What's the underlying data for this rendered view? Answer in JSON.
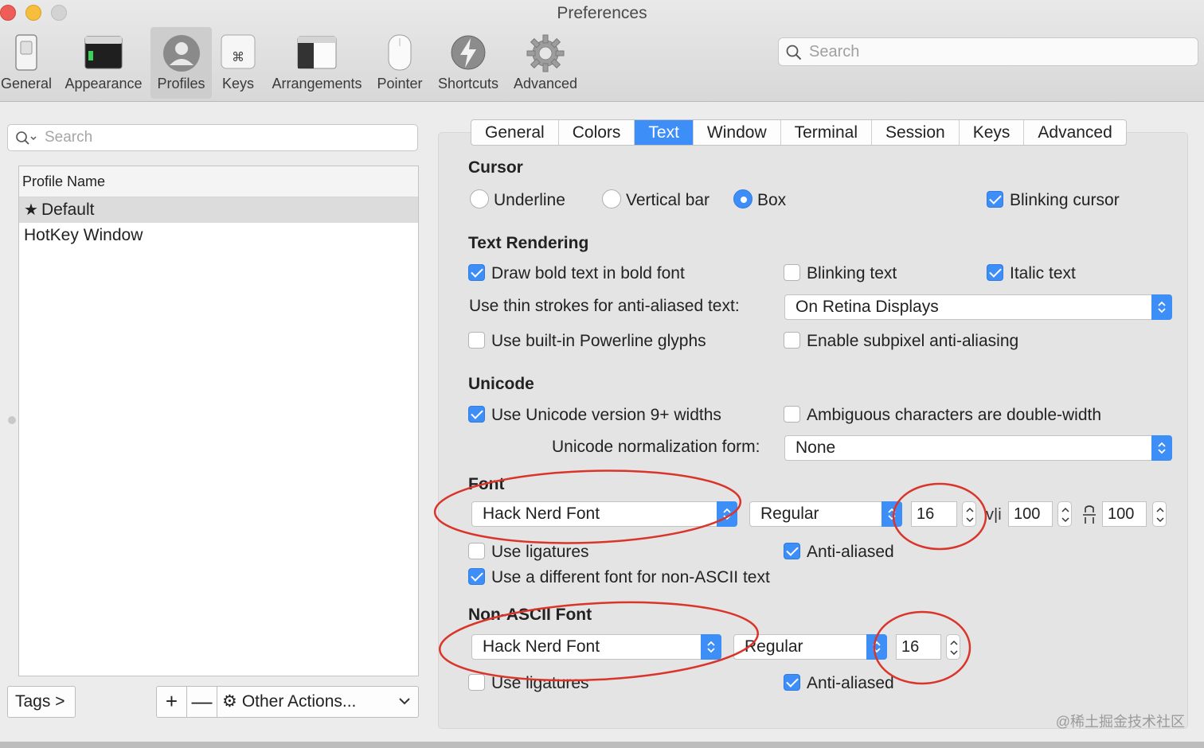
{
  "window": {
    "title": "Preferences"
  },
  "toolbar": {
    "items": [
      {
        "label": "General",
        "icon": "general-switch-icon"
      },
      {
        "label": "Appearance",
        "icon": "appearance-window-icon"
      },
      {
        "label": "Profiles",
        "icon": "profile-person-icon",
        "selected": true
      },
      {
        "label": "Keys",
        "icon": "command-key-icon"
      },
      {
        "label": "Arrangements",
        "icon": "arrangements-window-icon"
      },
      {
        "label": "Pointer",
        "icon": "mouse-icon"
      },
      {
        "label": "Shortcuts",
        "icon": "lightning-icon"
      },
      {
        "label": "Advanced",
        "icon": "gear-icon"
      }
    ],
    "search_placeholder": "Search"
  },
  "profiles": {
    "search_placeholder": "Search",
    "column_header": "Profile Name",
    "rows": [
      {
        "name": "Default",
        "default": true,
        "selected": true
      },
      {
        "name": "HotKey Window"
      }
    ],
    "tags_button": "Tags >",
    "add_button": "+",
    "remove_button": "—",
    "other_actions": "Other Actions..."
  },
  "tabs": [
    "General",
    "Colors",
    "Text",
    "Window",
    "Terminal",
    "Session",
    "Keys",
    "Advanced"
  ],
  "active_tab": "Text",
  "cursor": {
    "title": "Cursor",
    "underline": "Underline",
    "vertical_bar": "Vertical bar",
    "box": "Box",
    "selected": "Box",
    "blinking_cursor": "Blinking cursor",
    "blinking_cursor_checked": true
  },
  "text_rendering": {
    "title": "Text Rendering",
    "bold_in_bold": "Draw bold text in bold font",
    "bold_in_bold_checked": true,
    "blinking_text": "Blinking text",
    "blinking_text_checked": false,
    "italic_text": "Italic text",
    "italic_text_checked": true,
    "thin_strokes_label": "Use thin strokes for anti-aliased text:",
    "thin_strokes_value": "On Retina Displays",
    "powerline": "Use built-in Powerline glyphs",
    "powerline_checked": false,
    "subpixel": "Enable subpixel anti-aliasing",
    "subpixel_checked": false
  },
  "unicode": {
    "title": "Unicode",
    "v9_widths": "Use Unicode version 9+ widths",
    "v9_widths_checked": true,
    "ambiguous": "Ambiguous characters are double-width",
    "ambiguous_checked": false,
    "normalization_label": "Unicode normalization form:",
    "normalization_value": "None"
  },
  "font": {
    "title": "Font",
    "family": "Hack Nerd Font",
    "style": "Regular",
    "size": "16",
    "h_spacing": "100",
    "v_spacing": "100",
    "ligatures": "Use ligatures",
    "ligatures_checked": false,
    "anti_aliased": "Anti-aliased",
    "anti_aliased_checked": true,
    "non_ascii_diff": "Use a different font for non-ASCII text",
    "non_ascii_diff_checked": true
  },
  "non_ascii_font": {
    "title": "Non-ASCII Font",
    "family": "Hack Nerd Font",
    "style": "Regular",
    "size": "16",
    "ligatures": "Use ligatures",
    "ligatures_checked": false,
    "anti_aliased": "Anti-aliased",
    "anti_aliased_checked": true
  },
  "watermark": "@稀土掘金技术社区",
  "colors": {
    "accent": "#3d8ef7",
    "annotation": "#d9352b"
  }
}
